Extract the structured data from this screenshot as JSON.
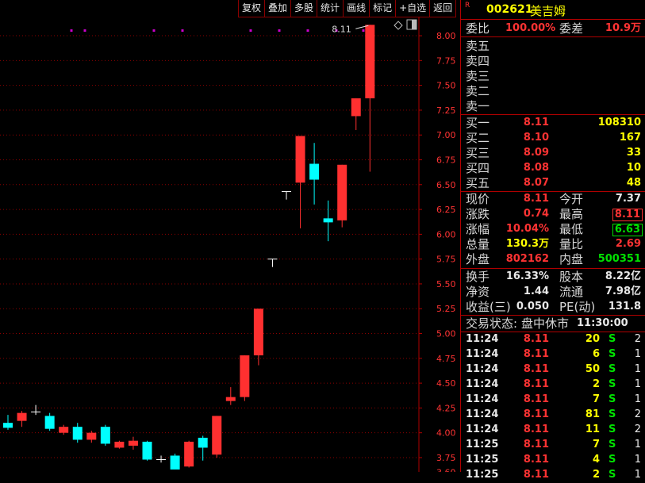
{
  "toolbar": [
    "复权",
    "叠加",
    "多股",
    "统计",
    "画线",
    "标记",
    "+自选",
    "返回"
  ],
  "stock": {
    "code": "002621",
    "name": "美吉姆",
    "badge": "R"
  },
  "ratio": {
    "label": "委比",
    "value": "100.00%",
    "diff_label": "委差",
    "diff_value": "10.9万"
  },
  "asks": [
    {
      "label": "卖五",
      "price": "",
      "vol": ""
    },
    {
      "label": "卖四",
      "price": "",
      "vol": ""
    },
    {
      "label": "卖三",
      "price": "",
      "vol": ""
    },
    {
      "label": "卖二",
      "price": "",
      "vol": ""
    },
    {
      "label": "卖一",
      "price": "",
      "vol": ""
    }
  ],
  "bids": [
    {
      "label": "买一",
      "price": "8.11",
      "vol": "108310"
    },
    {
      "label": "买二",
      "price": "8.10",
      "vol": "167"
    },
    {
      "label": "买三",
      "price": "8.09",
      "vol": "33"
    },
    {
      "label": "买四",
      "price": "8.08",
      "vol": "10"
    },
    {
      "label": "买五",
      "price": "8.07",
      "vol": "48"
    }
  ],
  "quote": {
    "now_label": "现价",
    "now": "8.11",
    "open_label": "今开",
    "open": "7.37",
    "chg_label": "涨跌",
    "chg": "0.74",
    "high_label": "最高",
    "high": "8.11",
    "pct_label": "涨幅",
    "pct": "10.04%",
    "low_label": "最低",
    "low": "6.63",
    "vol_label": "总量",
    "vol": "130.3万",
    "vr_label": "量比",
    "vr": "2.69",
    "outer_label": "外盘",
    "outer": "802162",
    "inner_label": "内盘",
    "inner": "500351"
  },
  "fund": {
    "turnover_label": "换手",
    "turnover": "16.33%",
    "equity_label": "股本",
    "equity": "8.22亿",
    "nav_label": "净资",
    "nav": "1.44",
    "float_label": "流通",
    "float": "7.98亿",
    "eps_label": "收益(三)",
    "eps": "0.050",
    "pe_label": "PE(动)",
    "pe": "131.8"
  },
  "status": {
    "label": "交易状态:",
    "value": "盘中休市",
    "time": "11:30:00"
  },
  "trades": [
    {
      "time": "11:24",
      "price": "8.11",
      "vol": "20",
      "side": "S",
      "n": "2"
    },
    {
      "time": "11:24",
      "price": "8.11",
      "vol": "6",
      "side": "S",
      "n": "1"
    },
    {
      "time": "11:24",
      "price": "8.11",
      "vol": "50",
      "side": "S",
      "n": "1"
    },
    {
      "time": "11:24",
      "price": "8.11",
      "vol": "2",
      "side": "S",
      "n": "1"
    },
    {
      "time": "11:24",
      "price": "8.11",
      "vol": "7",
      "side": "S",
      "n": "1"
    },
    {
      "time": "11:24",
      "price": "8.11",
      "vol": "81",
      "side": "S",
      "n": "2"
    },
    {
      "time": "11:24",
      "price": "8.11",
      "vol": "11",
      "side": "S",
      "n": "2"
    },
    {
      "time": "11:25",
      "price": "8.11",
      "vol": "7",
      "side": "S",
      "n": "1"
    },
    {
      "time": "11:25",
      "price": "8.11",
      "vol": "4",
      "side": "S",
      "n": "1"
    },
    {
      "time": "11:25",
      "price": "8.11",
      "vol": "2",
      "side": "S",
      "n": "1"
    }
  ],
  "chart_data": {
    "type": "candlestick",
    "ylim": [
      3.6,
      8.2
    ],
    "yticks": [
      "8.00",
      "7.75",
      "7.50",
      "7.25",
      "7.00",
      "6.75",
      "6.50",
      "6.25",
      "6.00",
      "5.75",
      "5.50",
      "5.25",
      "5.00",
      "4.75",
      "4.50",
      "4.25",
      "4.00",
      "3.75",
      "3.60"
    ],
    "max_label": "8.11",
    "colors": {
      "up": "#ff3030",
      "down": "#00ffff",
      "flat": "#ffffff",
      "marker": "#cc00cc"
    },
    "candles": [
      {
        "o": 4.1,
        "c": 4.05,
        "h": 4.18,
        "l": 4.03
      },
      {
        "o": 4.12,
        "c": 4.2,
        "h": 4.22,
        "l": 4.06
      },
      {
        "o": 4.21,
        "c": 4.21,
        "h": 4.28,
        "l": 4.18
      },
      {
        "o": 4.17,
        "c": 4.04,
        "h": 4.2,
        "l": 4.02
      },
      {
        "o": 4.0,
        "c": 4.06,
        "h": 4.08,
        "l": 3.98
      },
      {
        "o": 4.06,
        "c": 3.93,
        "h": 4.1,
        "l": 3.9
      },
      {
        "o": 3.93,
        "c": 4.0,
        "h": 4.02,
        "l": 3.9
      },
      {
        "o": 4.06,
        "c": 3.89,
        "h": 4.08,
        "l": 3.87
      },
      {
        "o": 3.85,
        "c": 3.91,
        "h": 3.92,
        "l": 3.84
      },
      {
        "o": 3.87,
        "c": 3.92,
        "h": 3.96,
        "l": 3.83
      },
      {
        "o": 3.91,
        "c": 3.73,
        "h": 3.92,
        "l": 3.72
      },
      {
        "o": 3.73,
        "c": 3.73,
        "h": 3.77,
        "l": 3.7
      },
      {
        "o": 3.77,
        "c": 3.63,
        "h": 3.79,
        "l": 3.63
      },
      {
        "o": 3.66,
        "c": 3.91,
        "h": 3.92,
        "l": 3.65
      },
      {
        "o": 3.95,
        "c": 3.85,
        "h": 3.97,
        "l": 3.72
      },
      {
        "o": 3.78,
        "c": 4.17,
        "h": 4.17,
        "l": 3.75
      },
      {
        "o": 4.32,
        "c": 4.36,
        "h": 4.46,
        "l": 4.28
      },
      {
        "o": 4.36,
        "c": 4.78,
        "h": 4.78,
        "l": 4.32
      },
      {
        "o": 4.78,
        "c": 5.25,
        "h": 5.25,
        "l": 4.68
      },
      {
        "o": 5.75,
        "c": 5.75,
        "h": 5.75,
        "l": 5.67
      },
      {
        "o": 6.43,
        "c": 6.43,
        "h": 6.43,
        "l": 6.35
      },
      {
        "o": 6.52,
        "c": 6.99,
        "h": 6.99,
        "l": 6.06
      },
      {
        "o": 6.71,
        "c": 6.55,
        "h": 6.92,
        "l": 6.3
      },
      {
        "o": 6.16,
        "c": 6.12,
        "h": 6.34,
        "l": 5.93
      },
      {
        "o": 6.14,
        "c": 6.7,
        "h": 6.7,
        "l": 6.07
      },
      {
        "o": 7.19,
        "c": 7.37,
        "h": 7.37,
        "l": 7.05
      },
      {
        "o": 7.37,
        "c": 8.11,
        "h": 8.11,
        "l": 6.63
      }
    ]
  }
}
